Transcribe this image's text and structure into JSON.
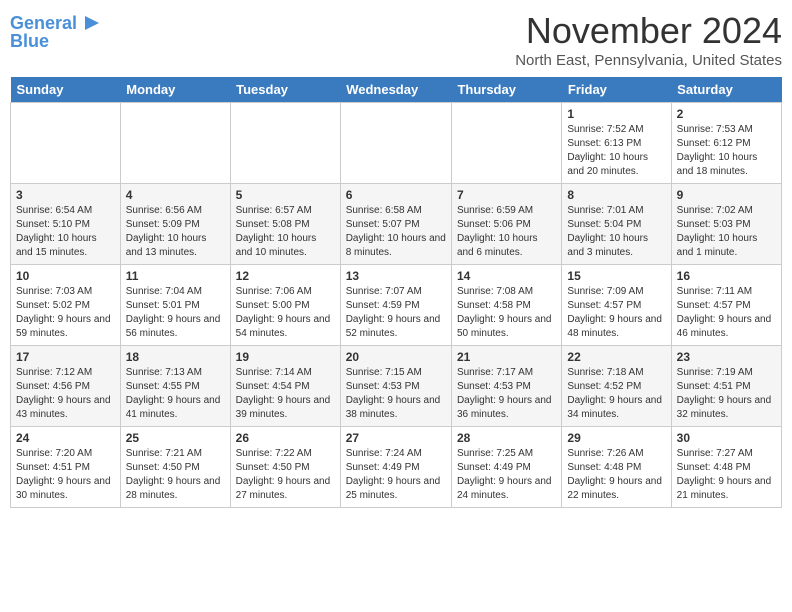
{
  "logo": {
    "line1": "General",
    "line2": "Blue"
  },
  "title": "November 2024",
  "location": "North East, Pennsylvania, United States",
  "days_of_week": [
    "Sunday",
    "Monday",
    "Tuesday",
    "Wednesday",
    "Thursday",
    "Friday",
    "Saturday"
  ],
  "weeks": [
    [
      {
        "day": "",
        "info": ""
      },
      {
        "day": "",
        "info": ""
      },
      {
        "day": "",
        "info": ""
      },
      {
        "day": "",
        "info": ""
      },
      {
        "day": "",
        "info": ""
      },
      {
        "day": "1",
        "info": "Sunrise: 7:52 AM\nSunset: 6:13 PM\nDaylight: 10 hours and 20 minutes."
      },
      {
        "day": "2",
        "info": "Sunrise: 7:53 AM\nSunset: 6:12 PM\nDaylight: 10 hours and 18 minutes."
      }
    ],
    [
      {
        "day": "3",
        "info": "Sunrise: 6:54 AM\nSunset: 5:10 PM\nDaylight: 10 hours and 15 minutes."
      },
      {
        "day": "4",
        "info": "Sunrise: 6:56 AM\nSunset: 5:09 PM\nDaylight: 10 hours and 13 minutes."
      },
      {
        "day": "5",
        "info": "Sunrise: 6:57 AM\nSunset: 5:08 PM\nDaylight: 10 hours and 10 minutes."
      },
      {
        "day": "6",
        "info": "Sunrise: 6:58 AM\nSunset: 5:07 PM\nDaylight: 10 hours and 8 minutes."
      },
      {
        "day": "7",
        "info": "Sunrise: 6:59 AM\nSunset: 5:06 PM\nDaylight: 10 hours and 6 minutes."
      },
      {
        "day": "8",
        "info": "Sunrise: 7:01 AM\nSunset: 5:04 PM\nDaylight: 10 hours and 3 minutes."
      },
      {
        "day": "9",
        "info": "Sunrise: 7:02 AM\nSunset: 5:03 PM\nDaylight: 10 hours and 1 minute."
      }
    ],
    [
      {
        "day": "10",
        "info": "Sunrise: 7:03 AM\nSunset: 5:02 PM\nDaylight: 9 hours and 59 minutes."
      },
      {
        "day": "11",
        "info": "Sunrise: 7:04 AM\nSunset: 5:01 PM\nDaylight: 9 hours and 56 minutes."
      },
      {
        "day": "12",
        "info": "Sunrise: 7:06 AM\nSunset: 5:00 PM\nDaylight: 9 hours and 54 minutes."
      },
      {
        "day": "13",
        "info": "Sunrise: 7:07 AM\nSunset: 4:59 PM\nDaylight: 9 hours and 52 minutes."
      },
      {
        "day": "14",
        "info": "Sunrise: 7:08 AM\nSunset: 4:58 PM\nDaylight: 9 hours and 50 minutes."
      },
      {
        "day": "15",
        "info": "Sunrise: 7:09 AM\nSunset: 4:57 PM\nDaylight: 9 hours and 48 minutes."
      },
      {
        "day": "16",
        "info": "Sunrise: 7:11 AM\nSunset: 4:57 PM\nDaylight: 9 hours and 46 minutes."
      }
    ],
    [
      {
        "day": "17",
        "info": "Sunrise: 7:12 AM\nSunset: 4:56 PM\nDaylight: 9 hours and 43 minutes."
      },
      {
        "day": "18",
        "info": "Sunrise: 7:13 AM\nSunset: 4:55 PM\nDaylight: 9 hours and 41 minutes."
      },
      {
        "day": "19",
        "info": "Sunrise: 7:14 AM\nSunset: 4:54 PM\nDaylight: 9 hours and 39 minutes."
      },
      {
        "day": "20",
        "info": "Sunrise: 7:15 AM\nSunset: 4:53 PM\nDaylight: 9 hours and 38 minutes."
      },
      {
        "day": "21",
        "info": "Sunrise: 7:17 AM\nSunset: 4:53 PM\nDaylight: 9 hours and 36 minutes."
      },
      {
        "day": "22",
        "info": "Sunrise: 7:18 AM\nSunset: 4:52 PM\nDaylight: 9 hours and 34 minutes."
      },
      {
        "day": "23",
        "info": "Sunrise: 7:19 AM\nSunset: 4:51 PM\nDaylight: 9 hours and 32 minutes."
      }
    ],
    [
      {
        "day": "24",
        "info": "Sunrise: 7:20 AM\nSunset: 4:51 PM\nDaylight: 9 hours and 30 minutes."
      },
      {
        "day": "25",
        "info": "Sunrise: 7:21 AM\nSunset: 4:50 PM\nDaylight: 9 hours and 28 minutes."
      },
      {
        "day": "26",
        "info": "Sunrise: 7:22 AM\nSunset: 4:50 PM\nDaylight: 9 hours and 27 minutes."
      },
      {
        "day": "27",
        "info": "Sunrise: 7:24 AM\nSunset: 4:49 PM\nDaylight: 9 hours and 25 minutes."
      },
      {
        "day": "28",
        "info": "Sunrise: 7:25 AM\nSunset: 4:49 PM\nDaylight: 9 hours and 24 minutes."
      },
      {
        "day": "29",
        "info": "Sunrise: 7:26 AM\nSunset: 4:48 PM\nDaylight: 9 hours and 22 minutes."
      },
      {
        "day": "30",
        "info": "Sunrise: 7:27 AM\nSunset: 4:48 PM\nDaylight: 9 hours and 21 minutes."
      }
    ]
  ]
}
